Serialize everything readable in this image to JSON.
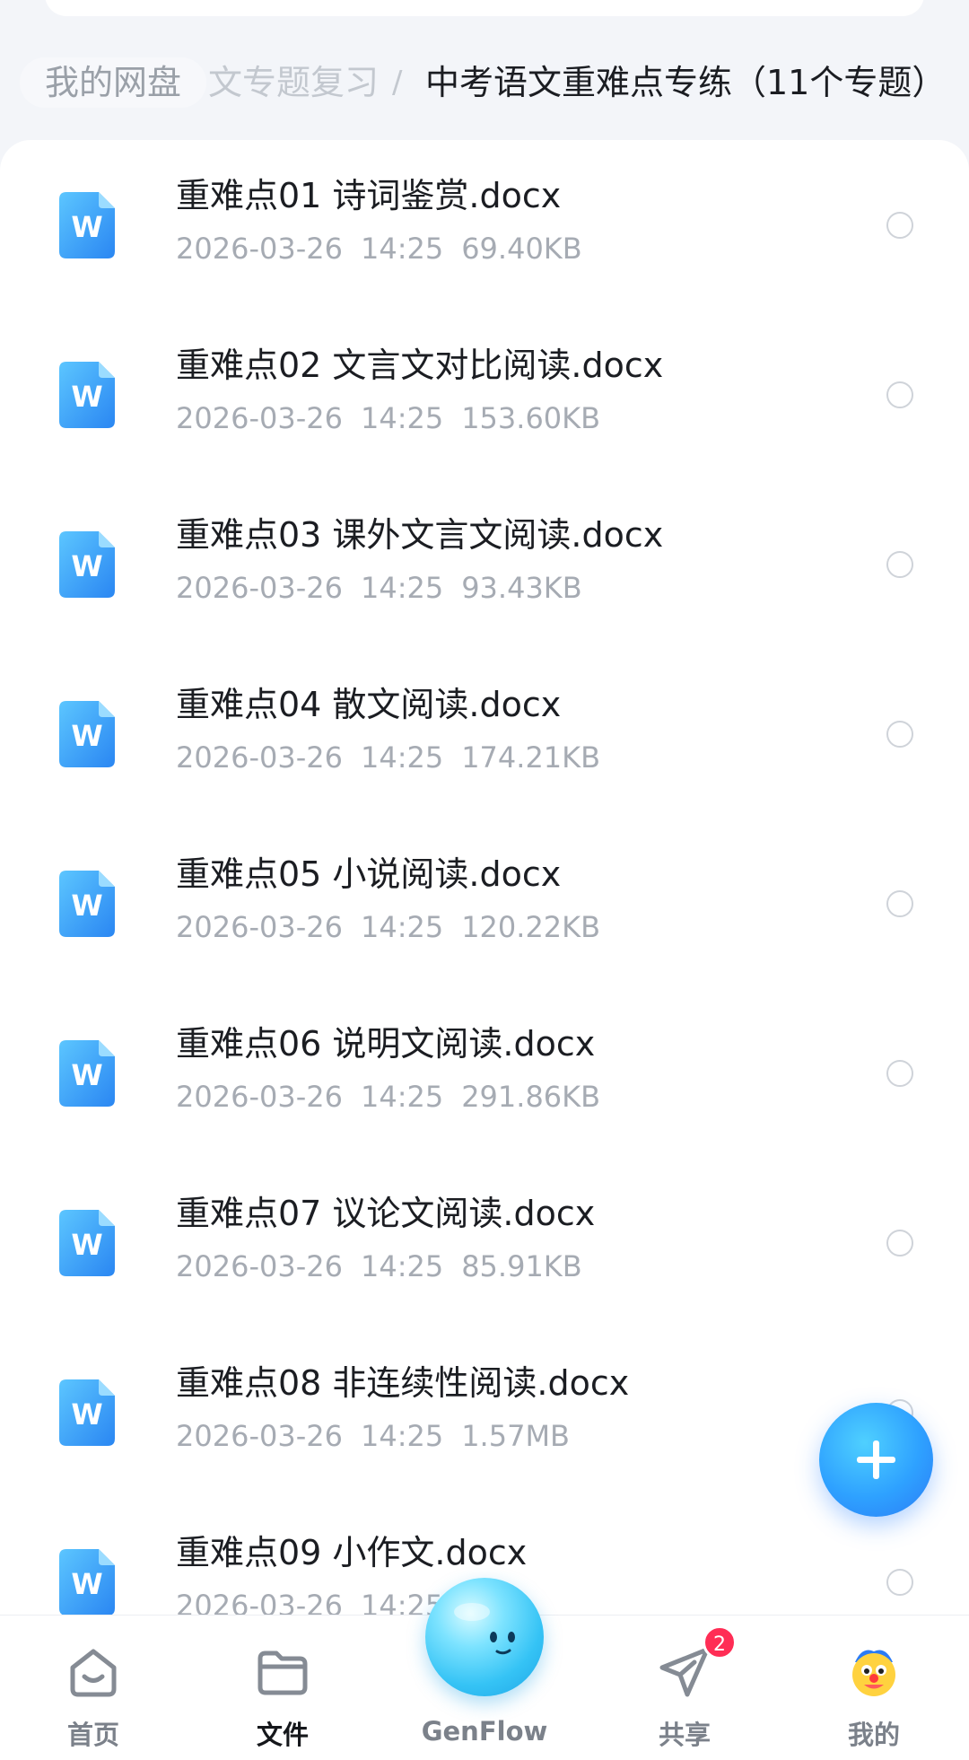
{
  "breadcrumb": {
    "root": "我的网盘",
    "middle": "文专题复习",
    "separator": "/",
    "current": "中考语文重难点专练（11个专题）"
  },
  "files": [
    {
      "name": "重难点01 诗词鉴赏.docx",
      "date": "2026-03-26",
      "time": "14:25",
      "size": "69.40KB"
    },
    {
      "name": "重难点02 文言文对比阅读.docx",
      "date": "2026-03-26",
      "time": "14:25",
      "size": "153.60KB"
    },
    {
      "name": "重难点03 课外文言文阅读.docx",
      "date": "2026-03-26",
      "time": "14:25",
      "size": "93.43KB"
    },
    {
      "name": "重难点04 散文阅读.docx",
      "date": "2026-03-26",
      "time": "14:25",
      "size": "174.21KB"
    },
    {
      "name": "重难点05 小说阅读.docx",
      "date": "2026-03-26",
      "time": "14:25",
      "size": "120.22KB"
    },
    {
      "name": "重难点06 说明文阅读.docx",
      "date": "2026-03-26",
      "time": "14:25",
      "size": "291.86KB"
    },
    {
      "name": "重难点07 议论文阅读.docx",
      "date": "2026-03-26",
      "time": "14:25",
      "size": "85.91KB"
    },
    {
      "name": "重难点08 非连续性阅读.docx",
      "date": "2026-03-26",
      "time": "14:25",
      "size": "1.57MB"
    },
    {
      "name": "重难点09 小作文.docx",
      "date": "2026-03-26",
      "time": "14:25",
      "size": ""
    }
  ],
  "fab": {
    "icon": "plus-icon"
  },
  "nav": {
    "home": {
      "label": "首页",
      "icon": "home-icon"
    },
    "files": {
      "label": "文件",
      "icon": "folder-icon"
    },
    "genflow": {
      "label": "GenFlow",
      "icon": "genflow-orb-icon"
    },
    "share": {
      "label": "共享",
      "icon": "paper-plane-icon",
      "badge": "2"
    },
    "me": {
      "label": "我的",
      "icon": "avatar-icon"
    }
  },
  "colors": {
    "accent": "#2ea1ff",
    "word_icon": "#2f8ef5",
    "badge": "#ff2d55"
  }
}
